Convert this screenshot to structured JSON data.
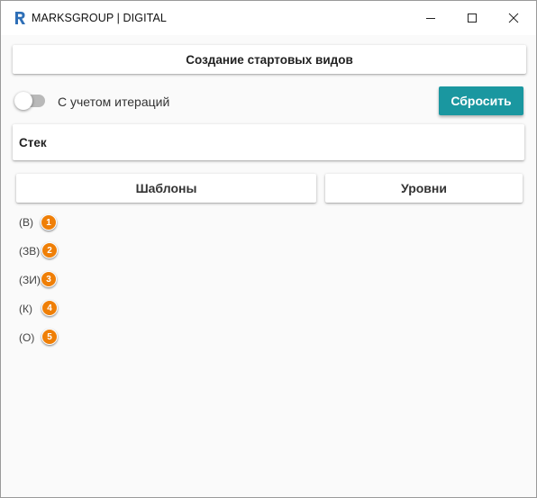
{
  "window": {
    "title": "MARKSGROUP | DIGITAL",
    "app_icon": "revit-r-icon",
    "controls": [
      "minimize-icon",
      "maximize-icon",
      "close-icon"
    ]
  },
  "header": {
    "title": "Создание стартовых видов"
  },
  "iteration_toggle": {
    "label": "С учетом итераций",
    "checked": false
  },
  "reset_button": {
    "label": "Сбросить",
    "color": "#1a97a0"
  },
  "stack": {
    "label": "Стек"
  },
  "tabs": [
    {
      "label": "Шаблоны"
    },
    {
      "label": "Уровни"
    }
  ],
  "items": [
    {
      "code": "(В)",
      "number": "1"
    },
    {
      "code": "(ЗВ)",
      "number": "2"
    },
    {
      "code": "(ЗИ)",
      "number": "3"
    },
    {
      "code": "(К)",
      "number": "4"
    },
    {
      "code": "(О)",
      "number": "5"
    }
  ],
  "colors": {
    "badge": "#ef7f07",
    "accent": "#1a97a0"
  }
}
